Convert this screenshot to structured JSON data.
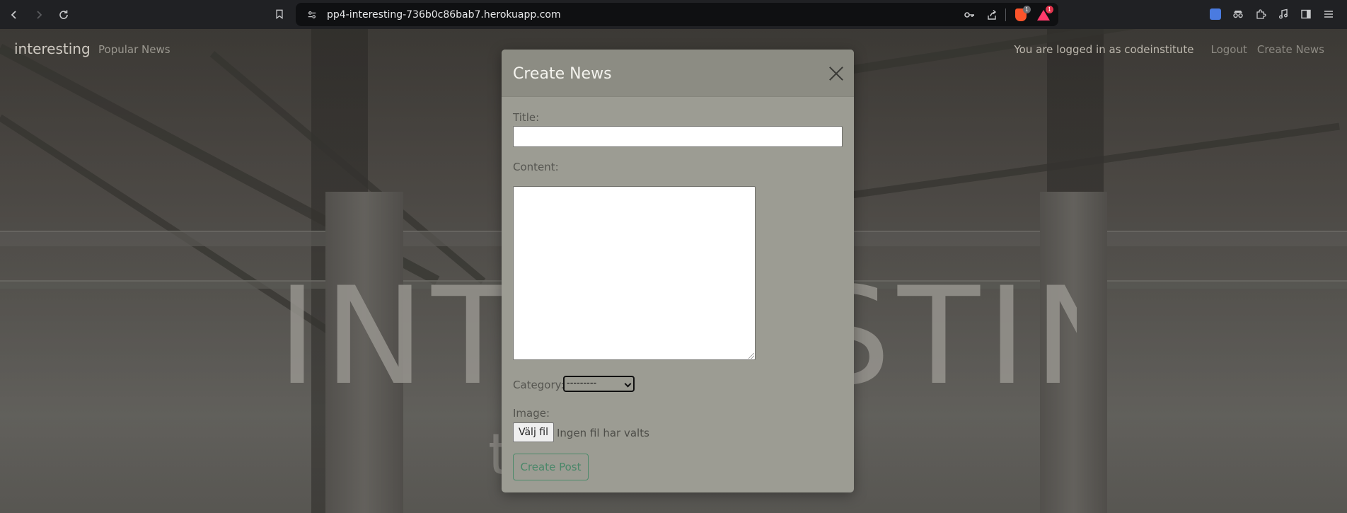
{
  "browser": {
    "url": "pp4-interesting-736b0c86bab7.herokuapp.com",
    "shield_badge": "1",
    "rewards_badge": "1"
  },
  "nav": {
    "brand": "interesting",
    "popular": "Popular News",
    "logged_in_text": "You are logged in as codeinstitute",
    "logout": "Logout",
    "create_news": "Create News"
  },
  "hero": {
    "title": "INTERESTING",
    "subtitle": "t"
  },
  "modal": {
    "title": "Create News",
    "title_label": "Title:",
    "title_value": "",
    "content_label": "Content:",
    "content_value": "",
    "category_label": "Category:",
    "category_selected": "---------",
    "image_label": "Image:",
    "file_button": "Välj fil",
    "file_status": "Ingen fil har valts",
    "submit": "Create Post"
  },
  "colors": {
    "modal_bg": "#9c9c93",
    "modal_header": "#8c8c83",
    "submit_accent": "#4a8769"
  }
}
